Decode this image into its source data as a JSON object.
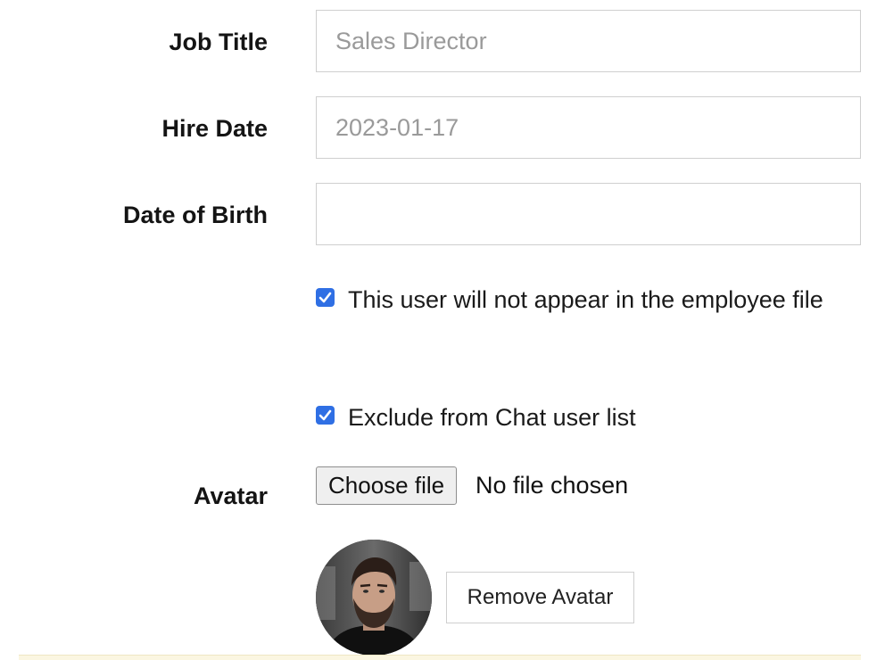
{
  "form": {
    "job_title": {
      "label": "Job Title",
      "value": "",
      "placeholder": "Sales Director"
    },
    "hire_date": {
      "label": "Hire Date",
      "value": "",
      "placeholder": "2023-01-17"
    },
    "date_of_birth": {
      "label": "Date of Birth",
      "value": "",
      "placeholder": ""
    },
    "hide_from_employee_file": {
      "checked": true,
      "label": "This user will not appear in the employee file"
    },
    "exclude_from_chat": {
      "checked": true,
      "label": "Exclude from Chat user list"
    },
    "avatar": {
      "label": "Avatar",
      "choose_file_label": "Choose file",
      "file_status": "No file chosen",
      "remove_label": "Remove Avatar"
    }
  },
  "colors": {
    "checkbox_accent": "#2f6fe4",
    "input_border": "#cfcfcf",
    "placeholder_text": "#9a9a9a",
    "bottom_notice_band": "#fbf6e1"
  }
}
